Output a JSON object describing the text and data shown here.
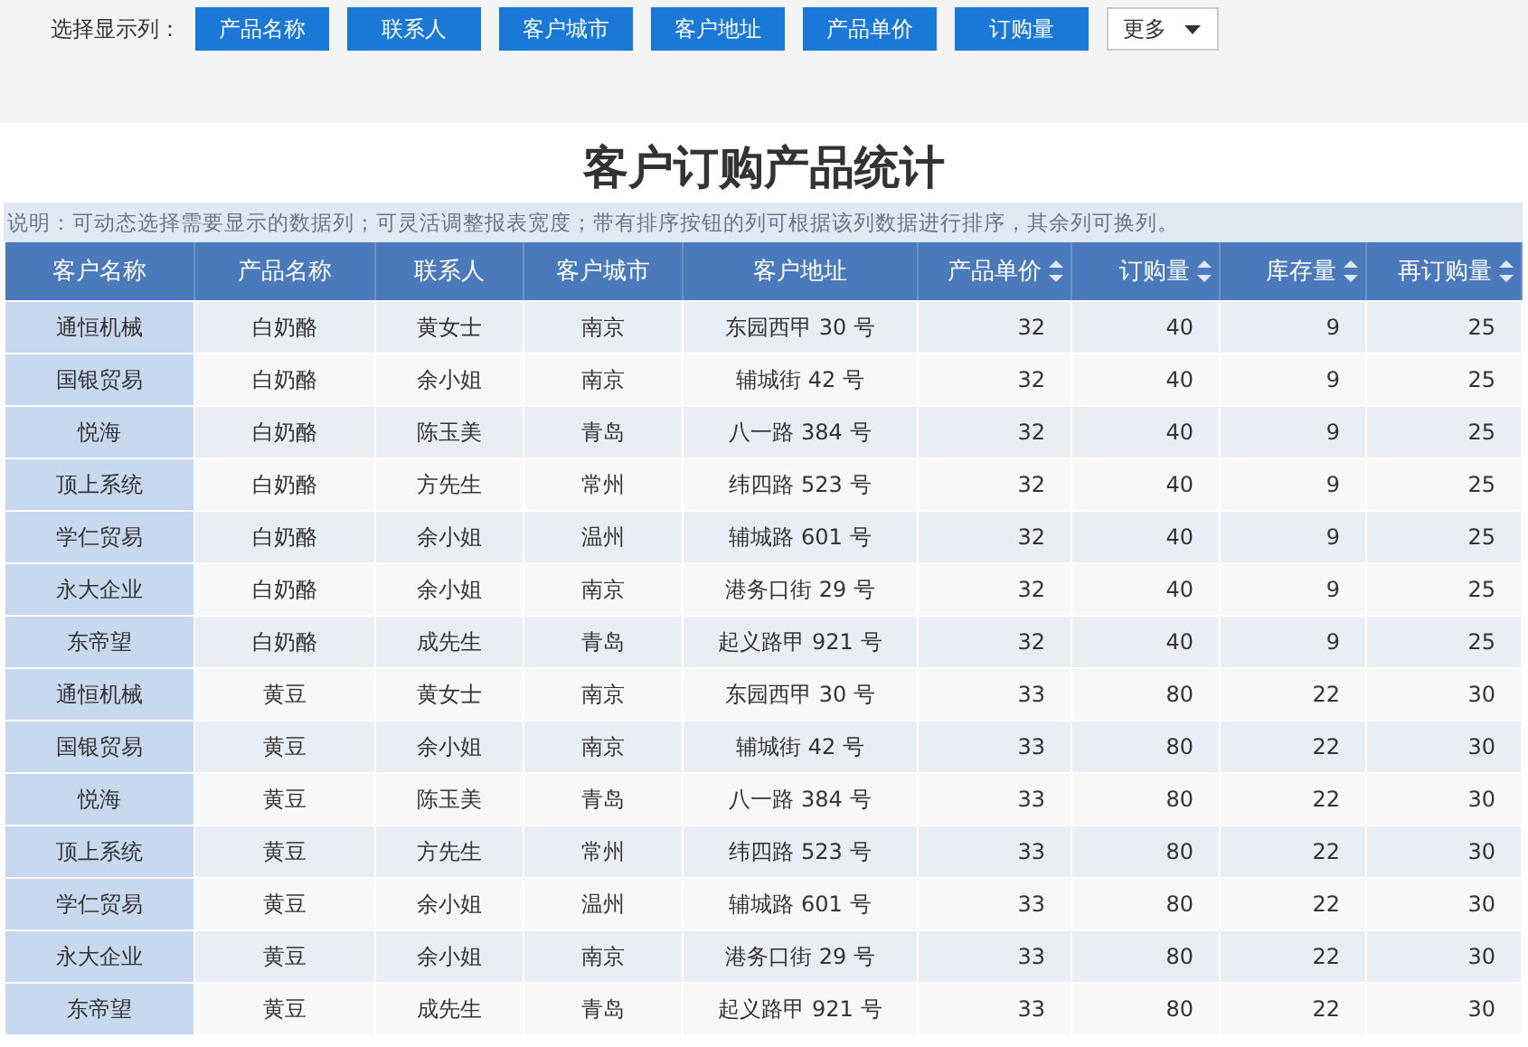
{
  "column_picker": {
    "label": "选择显示列：",
    "buttons": [
      "产品名称",
      "联系人",
      "客户城市",
      "客户地址",
      "产品单价",
      "订购量"
    ],
    "more": "更多"
  },
  "title": "客户订购产品统计",
  "note": "说明：可动态选择需要显示的数据列；可灵活调整报表宽度；带有排序按钮的列可根据该列数据进行排序，其余列可换列。",
  "table": {
    "columns": [
      {
        "label": "客户名称",
        "sortable": false
      },
      {
        "label": "产品名称",
        "sortable": false
      },
      {
        "label": "联系人",
        "sortable": false
      },
      {
        "label": "客户城市",
        "sortable": false
      },
      {
        "label": "客户地址",
        "sortable": false
      },
      {
        "label": "产品单价",
        "sortable": true
      },
      {
        "label": "订购量",
        "sortable": true
      },
      {
        "label": "库存量",
        "sortable": true
      },
      {
        "label": "再订购量",
        "sortable": true
      }
    ],
    "rows": [
      [
        "通恒机械",
        "白奶酪",
        "黄女士",
        "南京",
        "东园西甲 30 号",
        "32",
        "40",
        "9",
        "25"
      ],
      [
        "国银贸易",
        "白奶酪",
        "余小姐",
        "南京",
        "辅城街 42 号",
        "32",
        "40",
        "9",
        "25"
      ],
      [
        "悦海",
        "白奶酪",
        "陈玉美",
        "青岛",
        "八一路 384 号",
        "32",
        "40",
        "9",
        "25"
      ],
      [
        "顶上系统",
        "白奶酪",
        "方先生",
        "常州",
        "纬四路 523 号",
        "32",
        "40",
        "9",
        "25"
      ],
      [
        "学仁贸易",
        "白奶酪",
        "余小姐",
        "温州",
        "辅城路 601 号",
        "32",
        "40",
        "9",
        "25"
      ],
      [
        "永大企业",
        "白奶酪",
        "余小姐",
        "南京",
        "港务口街 29 号",
        "32",
        "40",
        "9",
        "25"
      ],
      [
        "东帝望",
        "白奶酪",
        "成先生",
        "青岛",
        "起义路甲 921 号",
        "32",
        "40",
        "9",
        "25"
      ],
      [
        "通恒机械",
        "黄豆",
        "黄女士",
        "南京",
        "东园西甲 30 号",
        "33",
        "80",
        "22",
        "30"
      ],
      [
        "国银贸易",
        "黄豆",
        "余小姐",
        "南京",
        "辅城街 42 号",
        "33",
        "80",
        "22",
        "30"
      ],
      [
        "悦海",
        "黄豆",
        "陈玉美",
        "青岛",
        "八一路 384 号",
        "33",
        "80",
        "22",
        "30"
      ],
      [
        "顶上系统",
        "黄豆",
        "方先生",
        "常州",
        "纬四路 523 号",
        "33",
        "80",
        "22",
        "30"
      ],
      [
        "学仁贸易",
        "黄豆",
        "余小姐",
        "温州",
        "辅城路 601 号",
        "33",
        "80",
        "22",
        "30"
      ],
      [
        "永大企业",
        "黄豆",
        "余小姐",
        "南京",
        "港务口街 29 号",
        "33",
        "80",
        "22",
        "30"
      ],
      [
        "东帝望",
        "黄豆",
        "成先生",
        "青岛",
        "起义路甲 921 号",
        "33",
        "80",
        "22",
        "30"
      ]
    ]
  }
}
